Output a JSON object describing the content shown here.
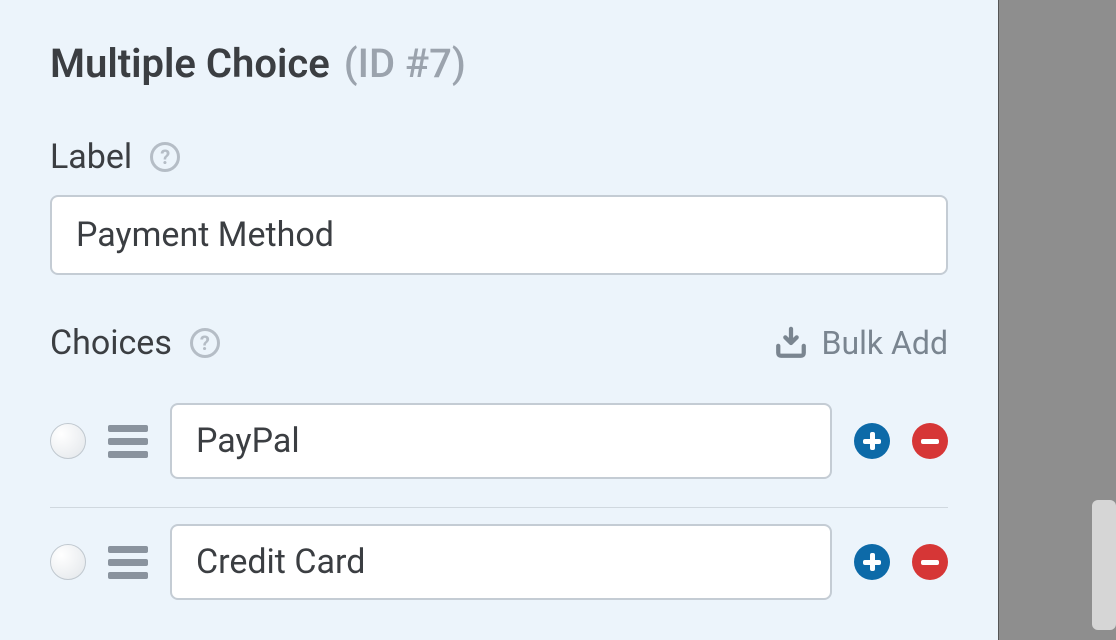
{
  "header": {
    "title": "Multiple Choice",
    "id_suffix": "(ID #7)"
  },
  "label_section": {
    "title": "Label",
    "value": "Payment Method"
  },
  "choices_section": {
    "title": "Choices",
    "bulk_add_label": "Bulk Add"
  },
  "choices": [
    {
      "value": "PayPal"
    },
    {
      "value": "Credit Card"
    }
  ]
}
